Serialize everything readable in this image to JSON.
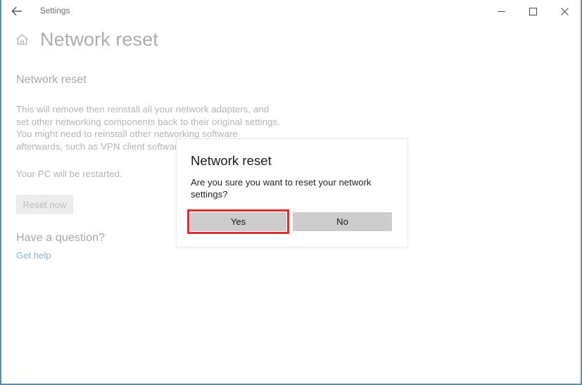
{
  "window": {
    "titlebar": {
      "back_icon": "back-arrow-icon",
      "title": "Settings",
      "minimize_icon": "minimize-icon",
      "maximize_icon": "maximize-icon",
      "close_icon": "close-icon"
    },
    "border_color": "#5b8fa8"
  },
  "header": {
    "home_icon": "home-icon",
    "title": "Network reset"
  },
  "main": {
    "section_heading": "Network reset",
    "description": "This will remove then reinstall all your network adapters, and set other networking components back to their original settings. You might need to reinstall other networking software afterwards, such as VPN client software or virtual switches.",
    "restart_note": "Your PC will be restarted.",
    "reset_button_label": "Reset now",
    "question_heading": "Have a question?",
    "get_help_label": "Get help"
  },
  "dialog": {
    "title": "Network reset",
    "message": "Are you sure you want to reset your network settings?",
    "yes_label": "Yes",
    "no_label": "No",
    "highlight_color": "#d83030",
    "button_color": "#cccccc"
  }
}
